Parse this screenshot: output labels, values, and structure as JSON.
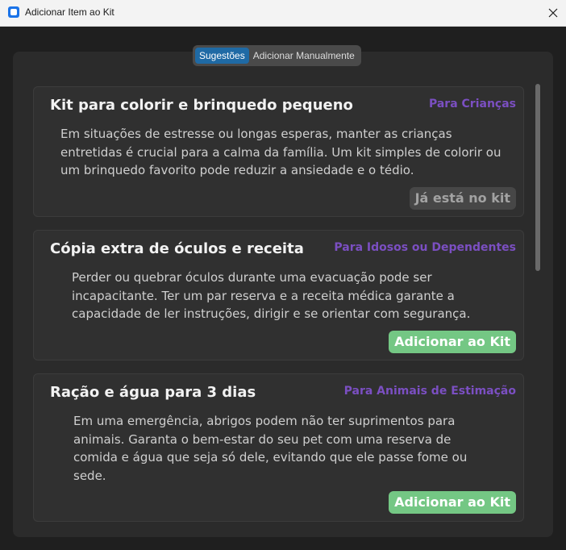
{
  "window": {
    "title": "Adicionar Item ao Kit"
  },
  "tabs": [
    {
      "label": "Sugestões",
      "active": true
    },
    {
      "label": "Adicionar Manualmente",
      "active": false
    }
  ],
  "cards": [
    {
      "title": "Kit para colorir e brinquedo pequeno",
      "category": "Para Crianças",
      "description": "Em situações de estresse ou longas esperas, manter as crianças entretidas é crucial para a calma da família. Um kit simples de colorir ou um brinquedo favorito pode reduzir a ansiedade e o tédio.",
      "button": "Já está no kit"
    },
    {
      "title": "Cópia extra de óculos e receita",
      "category": "Para Idosos ou Dependentes",
      "description": "Perder ou quebrar óculos durante uma evacuação pode ser incapacitante. Ter um par reserva e a receita médica garante a capacidade de ler instruções, dirigir e se orientar com segurança.",
      "button": "Adicionar ao Kit"
    },
    {
      "title": "Ração e água para 3 dias",
      "category": "Para Animais de Estimação",
      "description": "Em uma emergência, abrigos podem não ter suprimentos para animais. Garanta o bem-estar do seu pet com uma reserva de comida e água que seja só dele, evitando que ele passe fome ou sede.",
      "button": "Adicionar ao Kit"
    }
  ],
  "colors": {
    "category": "#7b4fc2",
    "add_button": "#74c784",
    "active_tab": "#1f6aa5"
  }
}
